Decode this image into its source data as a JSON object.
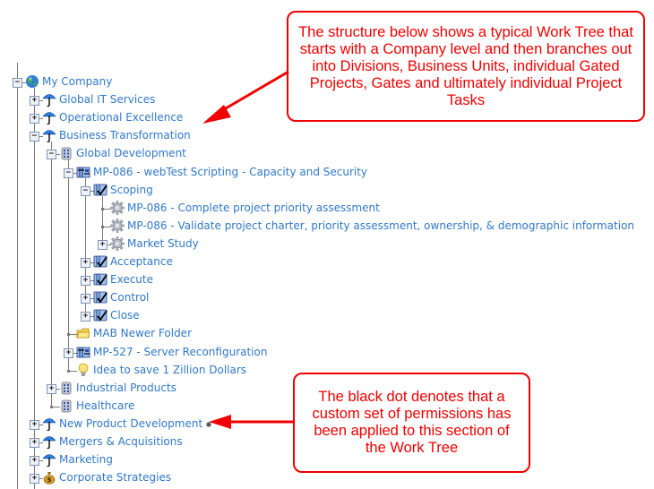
{
  "tree": {
    "nodes": [
      {
        "label": "My Company",
        "icon": "globe-icon",
        "state": "expanded"
      },
      {
        "label": "Global IT Services",
        "icon": "umbrella-icon",
        "state": "collapsed"
      },
      {
        "label": "Operational Excellence",
        "icon": "umbrella-icon",
        "state": "collapsed"
      },
      {
        "label": "Business Transformation",
        "icon": "umbrella-icon",
        "state": "expanded"
      },
      {
        "label": "Global Development",
        "icon": "building-icon",
        "state": "expanded"
      },
      {
        "label": "MP-086 - webTest Scripting - Capacity and Security",
        "icon": "gated-project-icon",
        "state": "expanded"
      },
      {
        "label": "Scoping",
        "icon": "gate-check-icon",
        "state": "expanded"
      },
      {
        "label": "MP-086 - Complete project priority assessment",
        "icon": "gear-icon",
        "state": "leaf"
      },
      {
        "label": "MP-086 - Validate project charter, priority assessment, ownership, & demographic information",
        "icon": "gear-icon",
        "state": "leaf"
      },
      {
        "label": "Market Study",
        "icon": "gear-icon",
        "state": "collapsed"
      },
      {
        "label": "Acceptance",
        "icon": "gate-check-icon",
        "state": "collapsed"
      },
      {
        "label": "Execute",
        "icon": "gate-check-icon",
        "state": "collapsed"
      },
      {
        "label": "Control",
        "icon": "gate-check-icon",
        "state": "collapsed"
      },
      {
        "label": "Close",
        "icon": "gate-check-icon",
        "state": "collapsed"
      },
      {
        "label": "MAB Newer Folder",
        "icon": "folder-icon",
        "state": "leaf"
      },
      {
        "label": "MP-527 - Server Reconfiguration",
        "icon": "gated-project-icon",
        "state": "collapsed"
      },
      {
        "label": "Idea to save 1 Zillion Dollars",
        "icon": "lightbulb-icon",
        "state": "leaf"
      },
      {
        "label": "Industrial Products",
        "icon": "building-icon",
        "state": "collapsed"
      },
      {
        "label": "Healthcare",
        "icon": "building-icon",
        "state": "leaf"
      },
      {
        "label": "New Product Development",
        "icon": "umbrella-icon",
        "state": "collapsed",
        "custom_permissions": true
      },
      {
        "label": "Mergers & Acquisitions",
        "icon": "umbrella-icon",
        "state": "collapsed"
      },
      {
        "label": "Marketing",
        "icon": "umbrella-icon",
        "state": "collapsed"
      },
      {
        "label": "Corporate Strategies",
        "icon": "money-bag-icon",
        "state": "collapsed"
      }
    ]
  },
  "callouts": {
    "top": "The structure below shows a typical Work Tree that starts with a Company level and then branches out into  Divisions, Business Units, individual Gated Projects, Gates and ultimately individual Project Tasks",
    "bottom": "The black dot denotes that a custom set of permissions has been applied to this section of the Work Tree"
  },
  "colors": {
    "link": "#3178c6",
    "annotation": "#f00000",
    "tree_line": "#7a7a7a"
  }
}
